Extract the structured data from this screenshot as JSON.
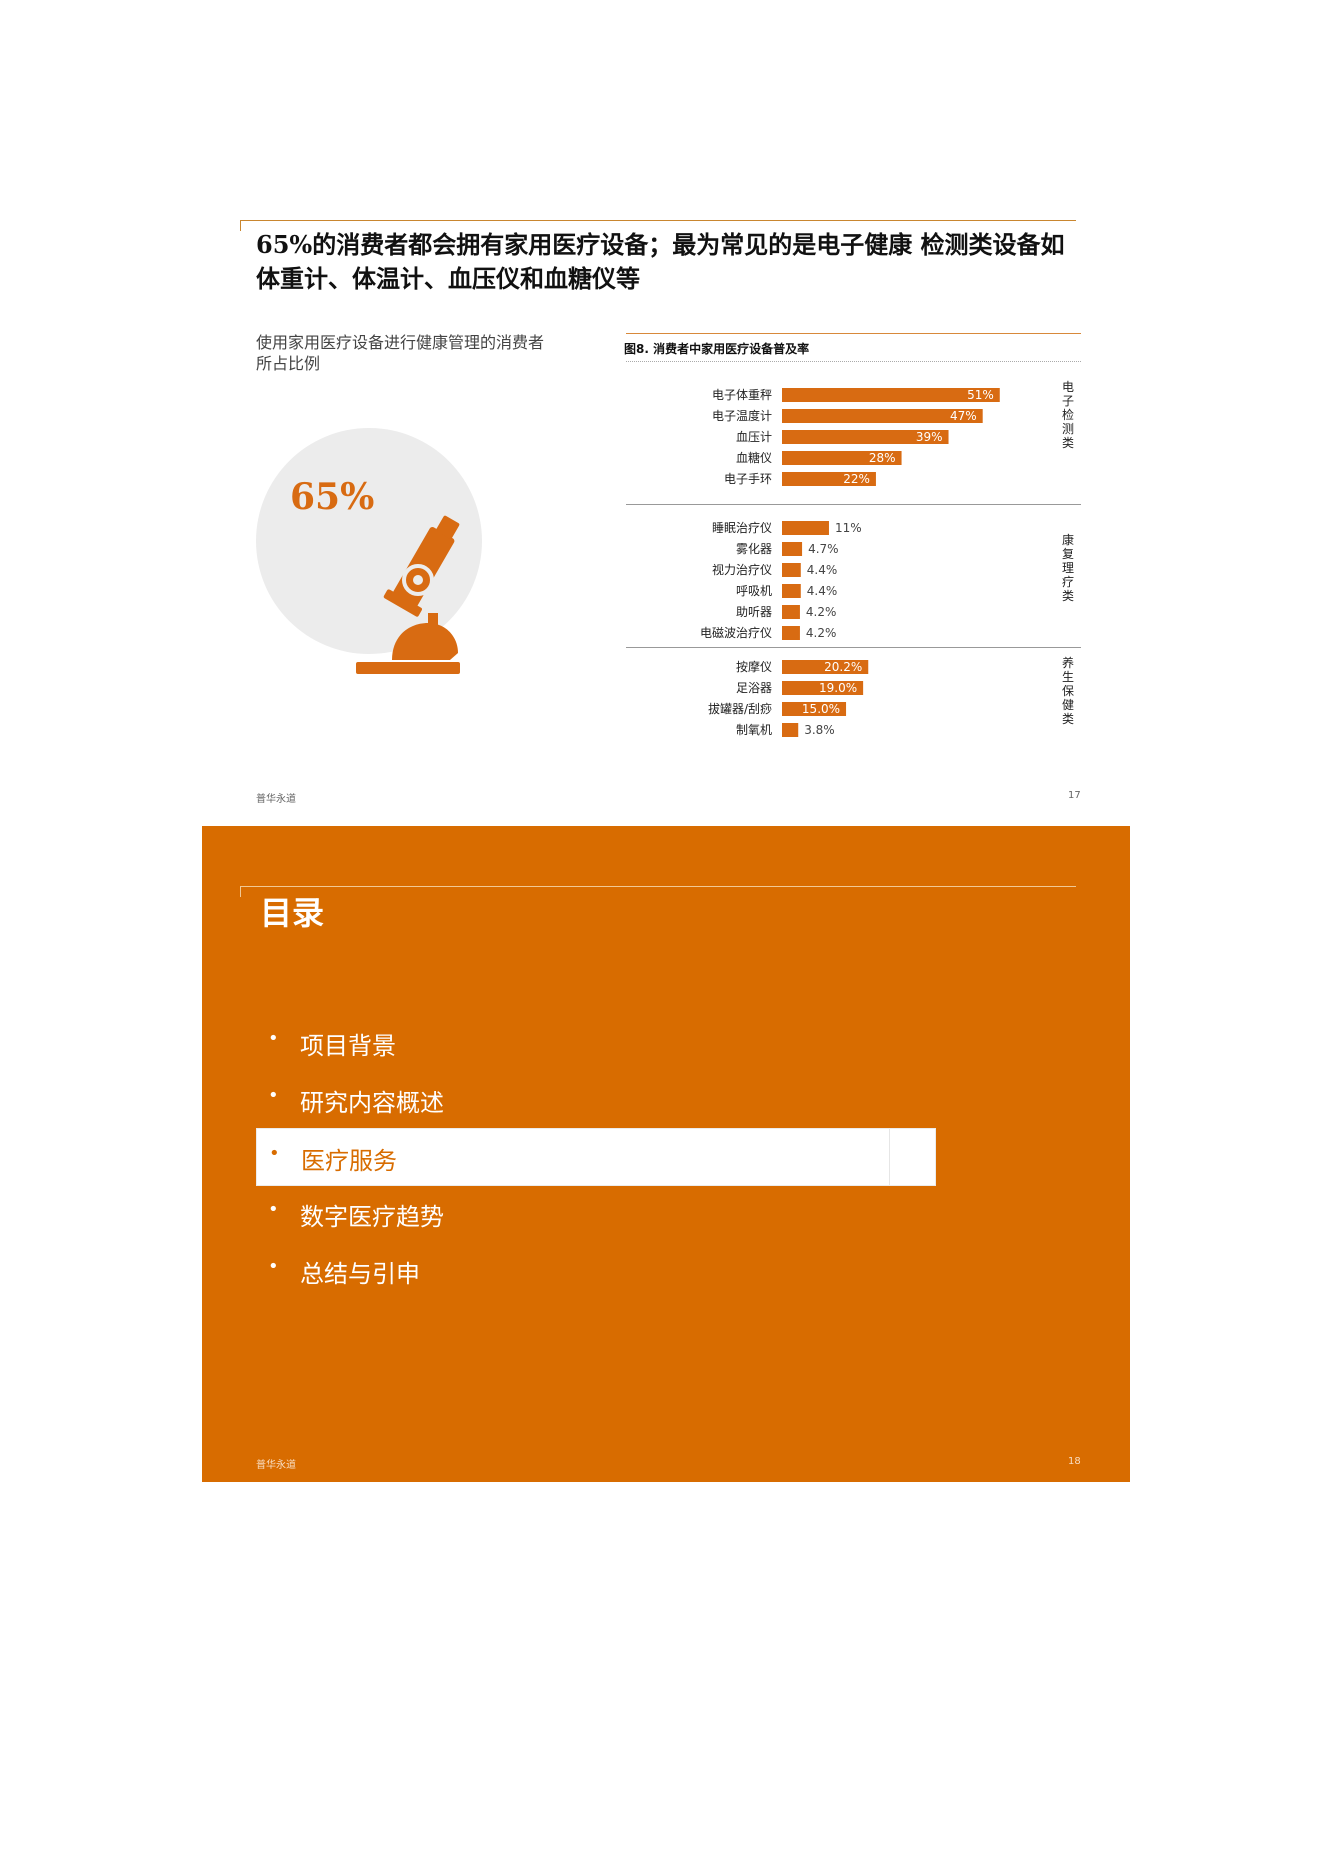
{
  "slide1": {
    "title": "65%的消费者都会拥有家用医疗设备；最为常见的是电子健康 检测类设备如体重计、体温计、血压仪和血糖仪等",
    "subtext": "使用家用医疗设备进行健康管理的消费者所占比例",
    "big_number": "65%",
    "icon": "microscope-icon",
    "footer_left": "普华永道",
    "footer_right": "17"
  },
  "chart_data": {
    "type": "bar",
    "title": "图8. 消费者中家用医疗设备普及率",
    "groups": [
      {
        "name": "电子检测类",
        "categories": [
          "电子体重秤",
          "电子温度计",
          "血压计",
          "血糖仪",
          "电子手环"
        ],
        "values": [
          51,
          47,
          39,
          28,
          22
        ],
        "labels": [
          "51%",
          "47%",
          "39%",
          "28%",
          "22%"
        ]
      },
      {
        "name": "康复理疗类",
        "categories": [
          "睡眠治疗仪",
          "雾化器",
          "视力治疗仪",
          "呼吸机",
          "助听器",
          "电磁波治疗仪"
        ],
        "values": [
          11,
          4.7,
          4.4,
          4.4,
          4.2,
          4.2
        ],
        "labels": [
          "11%",
          "4.7%",
          "4.4%",
          "4.4%",
          "4.2%",
          "4.2%"
        ]
      },
      {
        "name": "养生保健类",
        "categories": [
          "按摩仪",
          "足浴器",
          "拔罐器/刮痧",
          "制氧机"
        ],
        "values": [
          20.2,
          19.0,
          15.0,
          3.8
        ],
        "labels": [
          "20.2%",
          "19.0%",
          "15.0%",
          "3.8%"
        ]
      }
    ],
    "bar_color": "#d86b12"
  },
  "slide2": {
    "title": "目录",
    "items": [
      "项目背景",
      "研究内容概述",
      "医疗服务",
      "数字医疗趋势",
      "总结与引申"
    ],
    "active_index": 2,
    "background": "#d86c00",
    "footer_left": "普华永道",
    "footer_right": "18"
  }
}
